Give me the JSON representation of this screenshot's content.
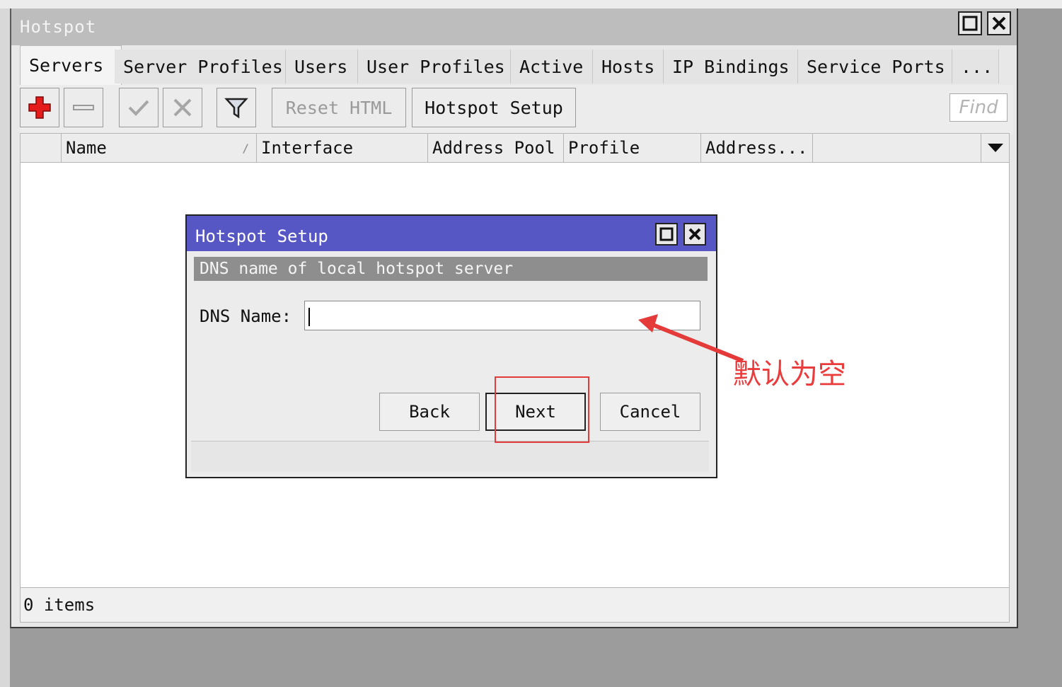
{
  "window": {
    "title": "Hotspot"
  },
  "tabs": [
    {
      "label": "Servers",
      "active": true
    },
    {
      "label": "Server Profiles"
    },
    {
      "label": "Users"
    },
    {
      "label": "User Profiles"
    },
    {
      "label": "Active"
    },
    {
      "label": "Hosts"
    },
    {
      "label": "IP Bindings"
    },
    {
      "label": "Service Ports"
    },
    {
      "label": "..."
    }
  ],
  "toolbar": {
    "add_icon": "plus-icon",
    "remove_icon": "minus-icon",
    "enable_icon": "check-icon",
    "disable_icon": "cross-icon",
    "filter_icon": "filter-icon",
    "reset_html_label": "Reset HTML",
    "hotspot_setup_label": "Hotspot Setup",
    "find_placeholder": "Find"
  },
  "table": {
    "columns": [
      "Name",
      "Interface",
      "Address Pool",
      "Profile",
      "Address..."
    ],
    "sort_indicator": "/",
    "rows": []
  },
  "status": {
    "items_text": "0 items"
  },
  "dialog": {
    "title": "Hotspot Setup",
    "section_header": "DNS name of local hotspot server",
    "dns_label": "DNS Name:",
    "dns_value": "",
    "buttons": {
      "back": "Back",
      "next": "Next",
      "cancel": "Cancel"
    }
  },
  "annotation": {
    "text": "默认为空",
    "color": "#ea3c3c"
  },
  "colors": {
    "dialog_title_bar": "#5657c4",
    "section_header": "#8e8e8e",
    "add_icon": "#e31b1b"
  }
}
